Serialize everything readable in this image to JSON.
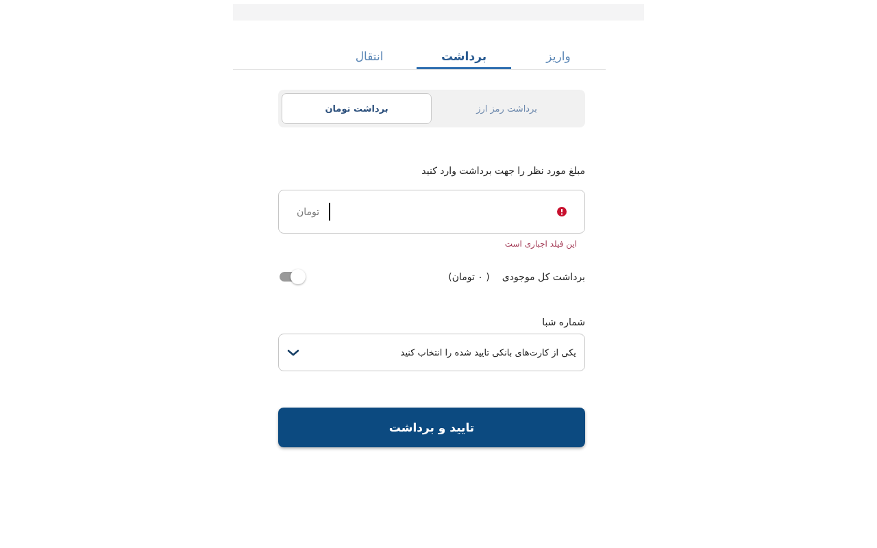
{
  "tabs": [
    {
      "label": "واریز",
      "selected": false
    },
    {
      "label": "برداشت",
      "selected": true
    },
    {
      "label": "انتقال",
      "selected": false
    }
  ],
  "withdraw_types": [
    {
      "label": "برداشت رمز ارز",
      "selected": false
    },
    {
      "label": "برداشت تومان",
      "selected": true
    }
  ],
  "amount": {
    "label": "مبلغ مورد نظر را جهت برداشت وارد کنید",
    "unit": "تومان",
    "focused": true,
    "error": "این فیلد اجباری است"
  },
  "withdraw_all": {
    "label": "برداشت کل موجودی",
    "balance": "( ۰ تومان)",
    "on": false
  },
  "sheba": {
    "label": "شماره شبا",
    "placeholder": "یکی از کارت‌های بانکی تایید شده را انتخاب کنید"
  },
  "submit": {
    "label": "تایید و برداشت"
  }
}
